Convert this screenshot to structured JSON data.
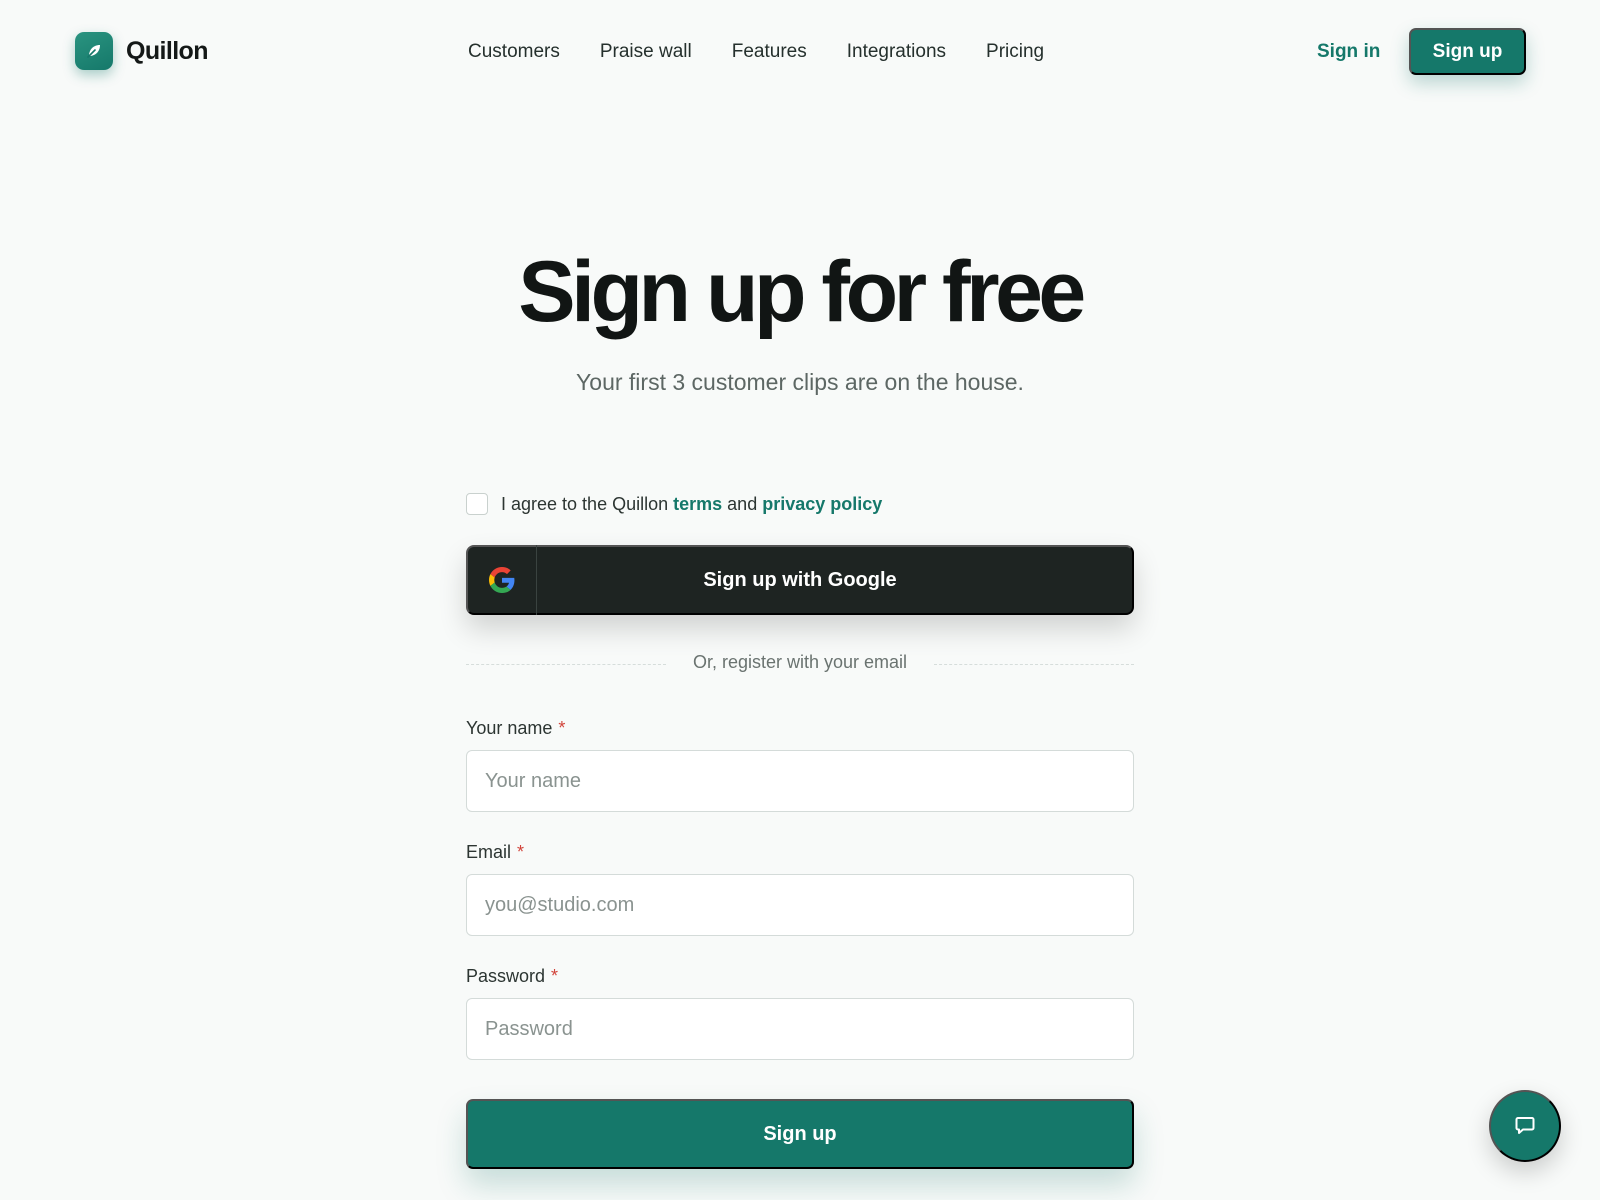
{
  "brand": {
    "name": "Quillon",
    "logo_icon": "leaf-icon",
    "accent": "#15786a"
  },
  "nav": {
    "items": [
      "Customers",
      "Praise wall",
      "Features",
      "Integrations",
      "Pricing"
    ],
    "sign_in": "Sign in",
    "sign_up": "Sign up"
  },
  "hero": {
    "title": "Sign up for free",
    "subtitle": "Your first 3 customer clips are on the house."
  },
  "form": {
    "agree": {
      "prefix": "I agree to the Quillon",
      "terms": "terms",
      "and": "and",
      "privacy": "privacy policy",
      "checked": false
    },
    "google_button": "Sign up with Google",
    "divider": "Or, register with your email",
    "fields": [
      {
        "label": "Your name",
        "required": "*",
        "placeholder": "Your name",
        "value": ""
      },
      {
        "label": "Email",
        "required": "*",
        "placeholder": "you@studio.com",
        "value": ""
      },
      {
        "label": "Password",
        "required": "*",
        "placeholder": "Password",
        "value": ""
      }
    ],
    "submit": "Sign up"
  },
  "chat": {
    "icon": "chat-bubble-icon"
  }
}
